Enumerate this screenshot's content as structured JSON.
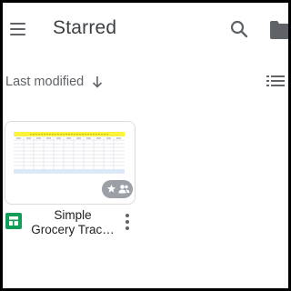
{
  "header": {
    "title": "Starred",
    "menu_icon": "menu-icon",
    "search_icon": "search-icon",
    "folder_icon": "folder-icon"
  },
  "sort": {
    "label": "Last modified",
    "direction_icon": "arrow-down-icon",
    "view_toggle_icon": "list-view-icon"
  },
  "files": [
    {
      "name": "Simple\nGrocery Trac…",
      "type_icon": "google-sheets-icon",
      "badges": [
        "star-icon",
        "shared-people-icon"
      ],
      "more_icon": "more-vert-icon"
    }
  ],
  "colors": {
    "icon_gray": "#5f6368",
    "title_text": "#3c4043",
    "sheets_green": "#0f9d58",
    "badge_gray": "#9aa0a6",
    "thumbnail_header_yellow": "#fff23a",
    "thumbnail_footer_blue": "#dce8f5"
  }
}
